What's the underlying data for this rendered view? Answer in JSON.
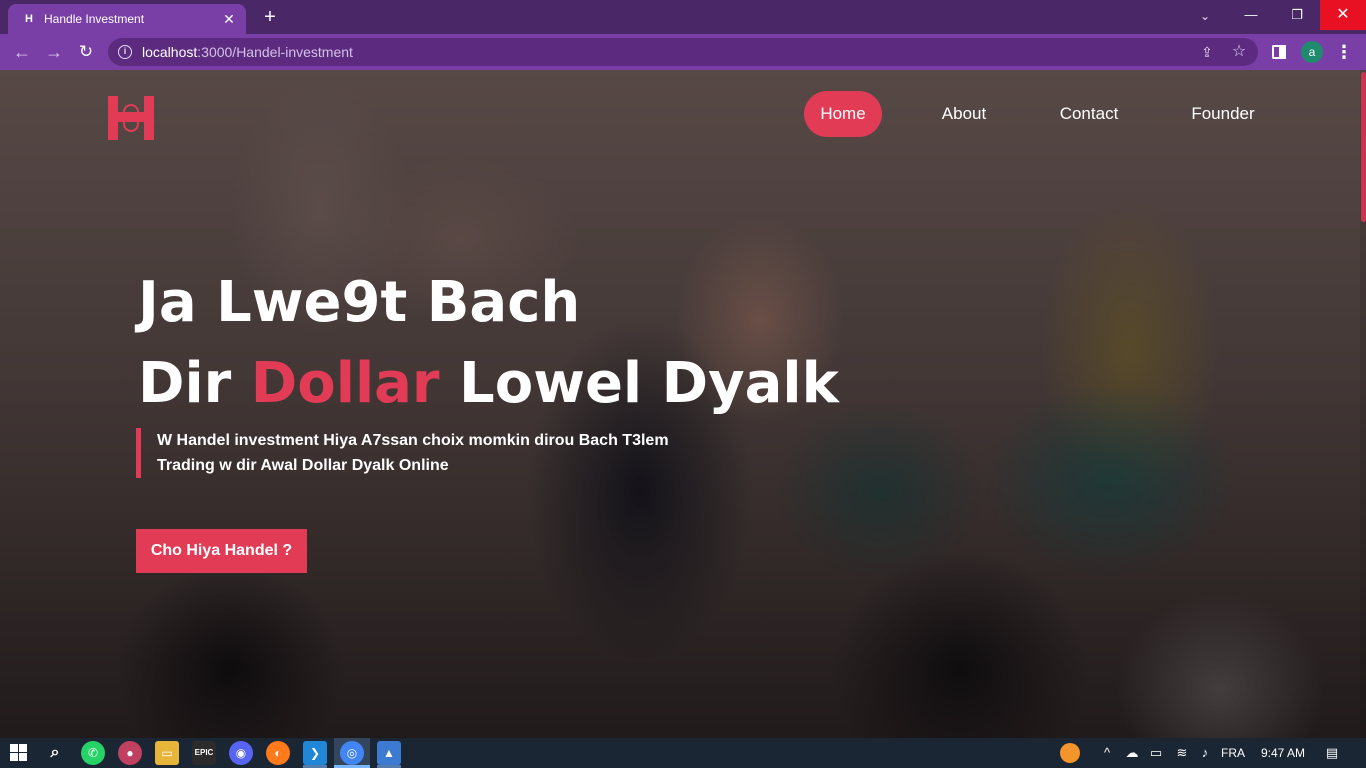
{
  "browser": {
    "tab": {
      "favicon": "H",
      "title": "Handle Investment",
      "close": "✕"
    },
    "new_tab": "+",
    "tab_search": "⌄",
    "window": {
      "minimize": "—",
      "maximize": "❐",
      "close": "✕"
    },
    "nav": {
      "back": "←",
      "forward": "→",
      "reload": "↻"
    },
    "url": {
      "host": "localhost",
      "path": ":3000/Handel-investment"
    },
    "profile_initial": "a",
    "menu": "⋮"
  },
  "site": {
    "nav": [
      "Home",
      "About",
      "Contact",
      "Founder"
    ],
    "active_nav": "Home",
    "headline": {
      "line1": "Ja Lwe9t Bach",
      "line2_pre": "Dir ",
      "line2_accent": "Dollar",
      "line2_post": " Lowel Dyalk"
    },
    "subtext": "W Handel investment Hiya A7ssan choix momkin dirou Bach T3lem Trading w dir Awal Dollar Dyalk Online",
    "cta": "Cho Hiya Handel ?"
  },
  "taskbar": {
    "apps": [
      "start",
      "search",
      "whatsapp",
      "bandicam",
      "file-explorer",
      "epic-games",
      "discord",
      "firefox",
      "vscode",
      "chrome",
      "photos"
    ],
    "active_app": "chrome",
    "epic_label": "EPIC",
    "lang": "FRA",
    "time": "9:47 AM"
  },
  "colors": {
    "accent": "#e23b55",
    "tabbar": "#4a2868",
    "toolbar": "#7a3fa6",
    "taskbar": "#1b2635"
  }
}
